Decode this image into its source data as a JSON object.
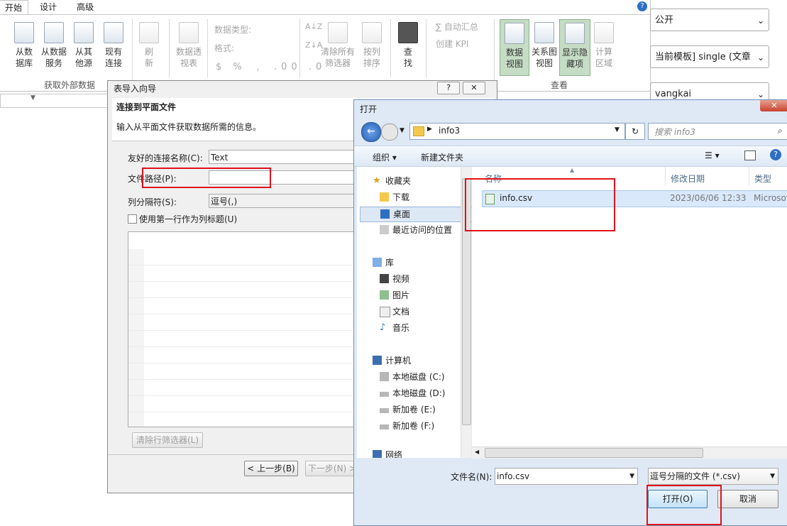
{
  "ribbon": {
    "tabs": [
      "开始",
      "设计",
      "高级"
    ],
    "buttons": {
      "from_db": [
        "从数",
        "据库"
      ],
      "from_service": [
        "从数据",
        "服务"
      ],
      "from_other": [
        "从其",
        "他源"
      ],
      "existing": [
        "现有",
        "连接"
      ],
      "refresh": [
        "刷",
        "新"
      ],
      "pivot": [
        "数据透",
        "视表"
      ],
      "data_type": "数据类型:",
      "format": "格式:",
      "sort_az": "A↓Z",
      "sort_za": "Z↓A",
      "clear_filter": [
        "清除所有",
        "筛选器"
      ],
      "sort_by": [
        "按列",
        "排序"
      ],
      "find": [
        "查",
        "找"
      ],
      "autosum": "∑ 自动汇总",
      "create_kpi": "创建 KPI",
      "data_view": [
        "数据",
        "视图"
      ],
      "diagram_view": [
        "关系图",
        "视图"
      ],
      "show_hidden": [
        "显示隐",
        "藏项"
      ],
      "calc_area": [
        "计算",
        "区域"
      ]
    },
    "groups": {
      "get_external": "获取外部数据",
      "view": "查看"
    }
  },
  "right_panel": {
    "dd1": "公开",
    "dd2": "当前模板] single (文章",
    "dd3": "vangkai"
  },
  "wizard": {
    "title": "表导入向导",
    "help_btn": "?",
    "close_btn": "✕",
    "heading": "连接到平面文件",
    "subheading": "输入从平面文件获取数据所需的信息。",
    "friendly_name_label": "友好的连接名称(C):",
    "friendly_name_value": "Text",
    "file_path_label": "文件路径(P):",
    "file_path_value": "",
    "delimiter_label": "列分隔符(S):",
    "delimiter_value": "逗号(,)",
    "first_row_header": "使用第一行作为列标题(U)",
    "clear_filters": "清除行筛选器(L)",
    "back": "< 上一步(B)",
    "next": "下一步(N) >"
  },
  "open_dialog": {
    "title": "打开",
    "close": "✕",
    "path": [
      "info3"
    ],
    "search_placeholder": "搜索 info3",
    "organize": "组织 ▾",
    "new_folder": "新建文件夹",
    "nav": {
      "favorites": "收藏夹",
      "downloads": "下载",
      "desktop": "桌面",
      "recent": "最近访问的位置",
      "libraries": "库",
      "videos": "视频",
      "pictures": "图片",
      "documents": "文档",
      "music": "音乐",
      "computer": "计算机",
      "disk_c": "本地磁盘 (C:)",
      "disk_d": "本地磁盘 (D:)",
      "vol_e": "新加卷 (E:)",
      "vol_f": "新加卷 (F:)",
      "network": "网络"
    },
    "columns": [
      "名称",
      "修改日期",
      "类型"
    ],
    "files": [
      {
        "name": "info.csv",
        "modified": "2023/06/06 12:33",
        "type": "Microsoft"
      }
    ],
    "filename_label": "文件名(N):",
    "filename_value": "info.csv",
    "filter_value": "逗号分隔的文件 (*.csv)",
    "open_btn": "打开(O)",
    "cancel_btn": "取消"
  }
}
